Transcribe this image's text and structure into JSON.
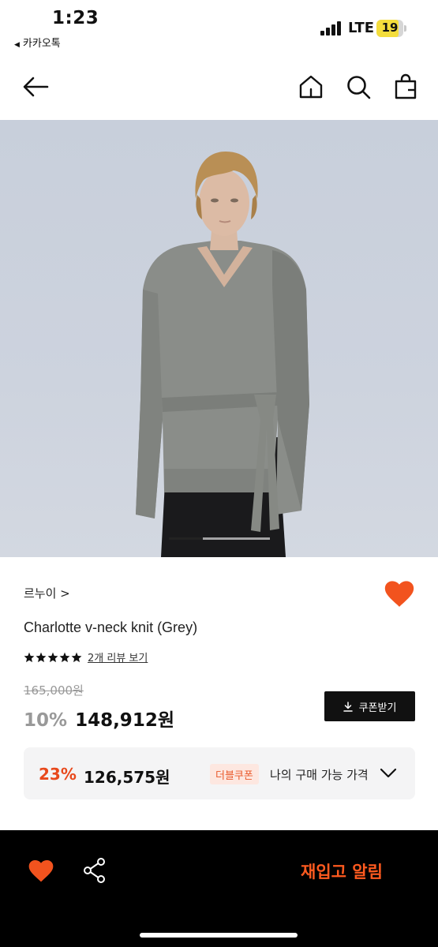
{
  "status_bar": {
    "time": "1:23",
    "back_app": "카카오톡",
    "network": "LTE",
    "battery": "19"
  },
  "nav": {
    "icons": [
      "back-arrow-icon",
      "home-icon",
      "search-icon",
      "shopping-bag-icon"
    ]
  },
  "gallery": {
    "image_index": 1,
    "image_count": 3
  },
  "product": {
    "brand": "르누이 >",
    "wishlisted": true,
    "name": "Charlotte v-neck knit (Grey)",
    "rating": 5,
    "review_link": "2개 리뷰 보기",
    "original_price": "165,000원",
    "discount": "10%",
    "price": "148,912원",
    "coupon_button": "쿠폰받기"
  },
  "my_price": {
    "discount": "23%",
    "price": "126,575원",
    "badge": "더블쿠폰",
    "label": "나의 구매 가능 가격"
  },
  "bottom_bar": {
    "restock_button": "재입고 알림"
  },
  "colors": {
    "accent": "#ff5a1f",
    "heart": "#f2531e",
    "discount_orange": "#e8491c",
    "badge_bg": "#fde7e0"
  }
}
